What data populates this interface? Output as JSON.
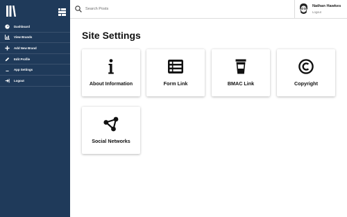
{
  "sidebar": {
    "items": [
      {
        "label": "Dashboard",
        "icon": "dashboard-icon"
      },
      {
        "label": "View Brands",
        "icon": "bar-chart-icon"
      },
      {
        "label": "Add New Brand",
        "icon": "plus-icon"
      },
      {
        "label": "Edit Profile",
        "icon": "edit-icon"
      },
      {
        "label": "App Settings",
        "icon": "settings-icon"
      },
      {
        "label": "Logout",
        "icon": "logout-icon"
      }
    ]
  },
  "header": {
    "search": {
      "placeholder": "Search Posts",
      "value": ""
    },
    "user": {
      "name": "Nathan Hawkes",
      "logout_label": "Logout"
    }
  },
  "main": {
    "title": "Site Settings",
    "cards": [
      {
        "label": "About Information",
        "icon": "info-icon"
      },
      {
        "label": "Form Link",
        "icon": "list-icon"
      },
      {
        "label": "BMAC Link",
        "icon": "coffee-cup-icon"
      },
      {
        "label": "Copyright",
        "icon": "copyright-icon"
      },
      {
        "label": "Social Networks",
        "icon": "share-network-icon"
      }
    ]
  },
  "colors": {
    "sidebar_bg": "#1f3a5a",
    "text_dark": "#111111"
  }
}
